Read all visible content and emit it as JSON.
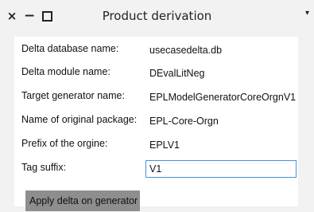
{
  "window": {
    "title": "Product derivation",
    "close_glyph": "×",
    "minimize_glyph": "−",
    "menu_glyph": "▾"
  },
  "form": {
    "fields": [
      {
        "label": "Delta database name:",
        "value": "usecasedelta.db"
      },
      {
        "label": "Delta module name:",
        "value": "DEvalLitNeg"
      },
      {
        "label": "Target generator name:",
        "value": "EPLModelGeneratorCoreOrgnV1"
      },
      {
        "label": "Name of original package:",
        "value": "EPL-Core-Orgn"
      },
      {
        "label": "Prefix of the orgine:",
        "value": "EPLV1"
      },
      {
        "label": "Tag suffix:",
        "value": "V1"
      }
    ],
    "apply_label": "Apply delta on generator"
  },
  "colors": {
    "focus_border": "#4a90d9",
    "button_bg": "#8e8e8e"
  }
}
